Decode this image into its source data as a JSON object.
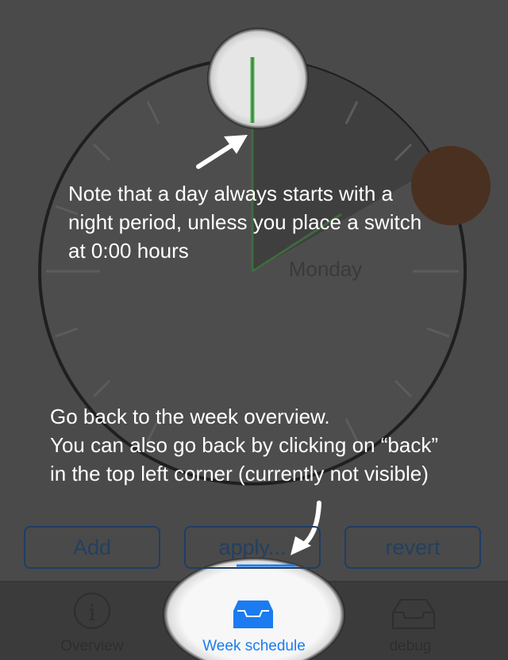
{
  "clock": {
    "day_label": "Monday"
  },
  "tips": {
    "night_note": [
      "Note that a day always starts with a",
      "night period, unless you place a switch",
      "at 0:00 hours"
    ],
    "back_note": [
      "Go back to the week overview.",
      "You can also go back by clicking  on “back”",
      "in the top left corner (currently not visible)"
    ]
  },
  "buttons": {
    "add_label": "Add",
    "apply_label": "apply...",
    "revert_label": "revert"
  },
  "tabbar": {
    "tabs": [
      {
        "label": "Overview",
        "icon": "info-circle-icon",
        "selected": false
      },
      {
        "label": "Week schedule",
        "icon": "inbox-tray-icon",
        "selected": true
      },
      {
        "label": "debug",
        "icon": "inbox-tray-icon",
        "selected": false
      }
    ]
  },
  "colors": {
    "accent": "#1a7cf0",
    "overlay_bg": "#4a4a4a",
    "night_segment": "#3f3f3f",
    "marker_green": "#4caf50",
    "handle_brown": "#4a3020"
  }
}
